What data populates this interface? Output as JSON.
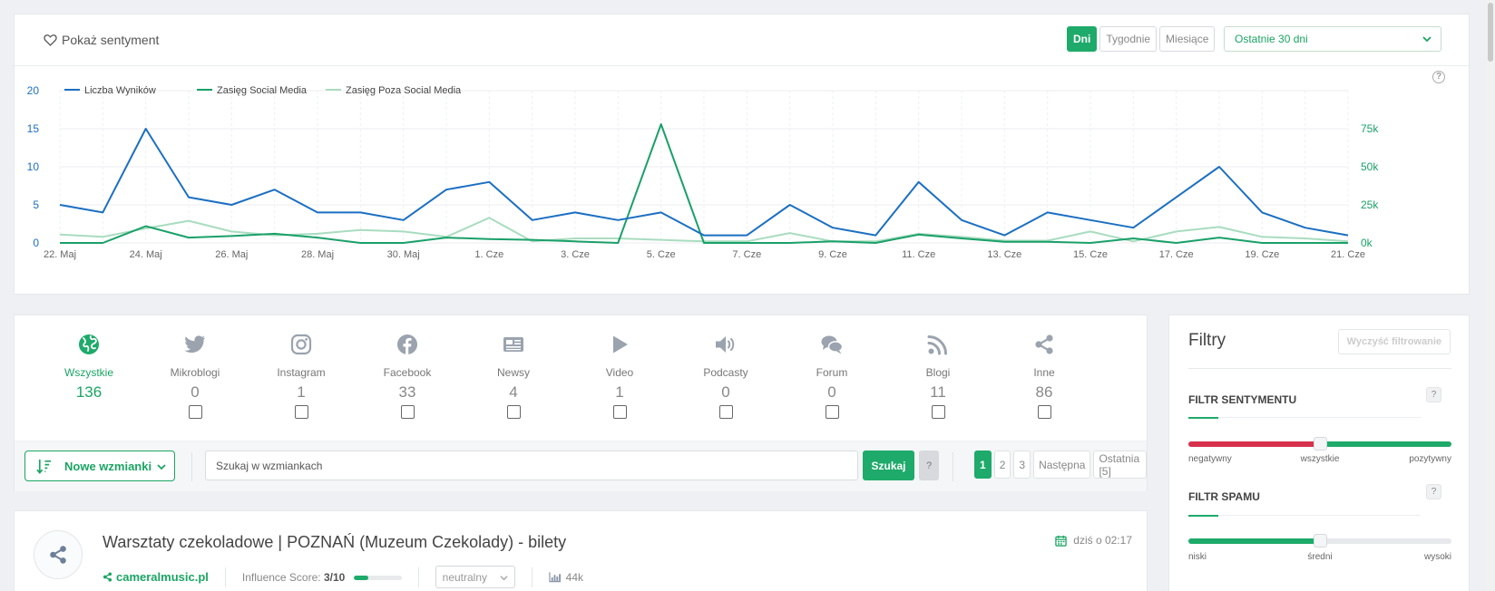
{
  "top_bar": {
    "sentiment_toggle": "Pokaż sentyment",
    "periods": [
      {
        "label": "Dni",
        "active": true
      },
      {
        "label": "Tygodnie",
        "active": false
      },
      {
        "label": "Miesiące",
        "active": false
      }
    ],
    "range": "Ostatnie 30 dni",
    "help": "?"
  },
  "chart_data": {
    "type": "line",
    "x": [
      "22. Maj",
      "23. Maj",
      "24. Maj",
      "25. Maj",
      "26. Maj",
      "27. Maj",
      "28. Maj",
      "29. Maj",
      "30. Maj",
      "31. Maj",
      "1. Cze",
      "2. Cze",
      "3. Cze",
      "4. Cze",
      "5. Cze",
      "6. Cze",
      "7. Cze",
      "8. Cze",
      "9. Cze",
      "10. Cze",
      "11. Cze",
      "12. Cze",
      "13. Cze",
      "14. Cze",
      "15. Cze",
      "16. Cze",
      "17. Cze",
      "18. Cze",
      "19. Cze",
      "20. Cze",
      "21. Cze"
    ],
    "x_tick_labels": [
      "22. Maj",
      "24. Maj",
      "26. Maj",
      "28. Maj",
      "30. Maj",
      "1. Cze",
      "3. Cze",
      "5. Cze",
      "7. Cze",
      "9. Cze",
      "11. Cze",
      "13. Cze",
      "15. Cze",
      "17. Cze",
      "19. Cze",
      "21. Cze"
    ],
    "y_left": {
      "min": 0,
      "max": 20,
      "ticks": [
        "0",
        "5",
        "10",
        "15",
        "20"
      ]
    },
    "y_right": {
      "min": 0,
      "max": 100000,
      "ticks": [
        {
          "value": 0,
          "label": "0k"
        },
        {
          "value": 25000,
          "label": "25k"
        },
        {
          "value": 50000,
          "label": "50k"
        },
        {
          "value": 75000,
          "label": "75k"
        }
      ]
    },
    "grid": true,
    "legend_placement": "top-left",
    "series": [
      {
        "name": "Liczba Wyników",
        "axis": "left",
        "color": "#1b6fc2",
        "values": [
          5,
          4,
          15,
          6,
          5,
          7,
          4,
          4,
          3,
          7,
          8,
          3,
          4,
          3,
          4,
          1,
          1,
          5,
          2,
          1,
          8,
          3,
          1,
          4,
          3,
          2,
          6,
          10,
          4,
          2,
          1
        ]
      },
      {
        "name": "Zasięg Social Media",
        "axis": "right",
        "color": "#1aa069",
        "values": [
          0,
          0,
          11000,
          3500,
          4500,
          6000,
          3500,
          0,
          0,
          3500,
          2500,
          2000,
          1000,
          0,
          78000,
          0,
          0,
          0,
          1000,
          0,
          5500,
          3000,
          800,
          800,
          0,
          3000,
          0,
          3500,
          0,
          0,
          0
        ]
      },
      {
        "name": "Zasięg Poza Social Media",
        "axis": "right",
        "color": "#a9dcc0",
        "values": [
          5500,
          4000,
          9500,
          14500,
          7500,
          5000,
          6000,
          8500,
          7500,
          4000,
          16500,
          1000,
          3000,
          3000,
          2000,
          1000,
          1000,
          6500,
          1000,
          1000,
          6000,
          4000,
          1500,
          1500,
          7500,
          1000,
          7500,
          10500,
          4000,
          3000,
          1000
        ]
      }
    ]
  },
  "channels": [
    {
      "label": "Wszystkie",
      "count": "136",
      "icon": "globe-icon",
      "active": true,
      "checkbox": false
    },
    {
      "label": "Mikroblogi",
      "count": "0",
      "icon": "twitter-bird-icon",
      "active": false,
      "checkbox": true
    },
    {
      "label": "Instagram",
      "count": "1",
      "icon": "instagram-icon",
      "active": false,
      "checkbox": true
    },
    {
      "label": "Facebook",
      "count": "33",
      "icon": "facebook-icon",
      "active": false,
      "checkbox": true
    },
    {
      "label": "Newsy",
      "count": "4",
      "icon": "newspaper-icon",
      "active": false,
      "checkbox": true
    },
    {
      "label": "Video",
      "count": "1",
      "icon": "play-icon",
      "active": false,
      "checkbox": true
    },
    {
      "label": "Podcasty",
      "count": "0",
      "icon": "speaker-icon",
      "active": false,
      "checkbox": true
    },
    {
      "label": "Forum",
      "count": "0",
      "icon": "chat-bubbles-icon",
      "active": false,
      "checkbox": true
    },
    {
      "label": "Blogi",
      "count": "11",
      "icon": "rss-icon",
      "active": false,
      "checkbox": true
    },
    {
      "label": "Inne",
      "count": "86",
      "icon": "share-icon",
      "active": false,
      "checkbox": true
    }
  ],
  "toolbar": {
    "sort_label": "Nowe wzmianki",
    "search_placeholder": "Szukaj w wzmiankach",
    "search_button": "Szukaj",
    "help": "?",
    "pagination": [
      {
        "label": "1",
        "active": true
      },
      {
        "label": "2",
        "active": false
      },
      {
        "label": "3",
        "active": false
      },
      {
        "label": "Następna",
        "active": false
      },
      {
        "label": "Ostatnia [5]",
        "active": false
      }
    ]
  },
  "mention": {
    "title": "Warsztaty czekoladowe | POZNAŃ (Muzeum Czekolady) - bilety",
    "date": "dziś o 02:17",
    "source": "cameralmusic.pl",
    "influence_label": "Influence Score:",
    "influence_value": "3/10",
    "influence_fraction": 0.3,
    "sentiment": "neutralny",
    "reach": "44k"
  },
  "filters": {
    "title": "Filtry",
    "clear_button": "Wyczyść filtrowanie",
    "help": "?",
    "sentiment": {
      "label": "FILTR SENTYMENTU",
      "value": 0.5,
      "labels": [
        "negatywny",
        "wszystkie",
        "pozytywny"
      ]
    },
    "spam": {
      "label": "FILTR SPAMU",
      "value": 0.5,
      "labels": [
        "niski",
        "średni",
        "wysoki"
      ]
    }
  },
  "colors": {
    "accent": "#1eaa6a",
    "negative": "#d6304d",
    "primary_blue": "#1b6fc2"
  }
}
